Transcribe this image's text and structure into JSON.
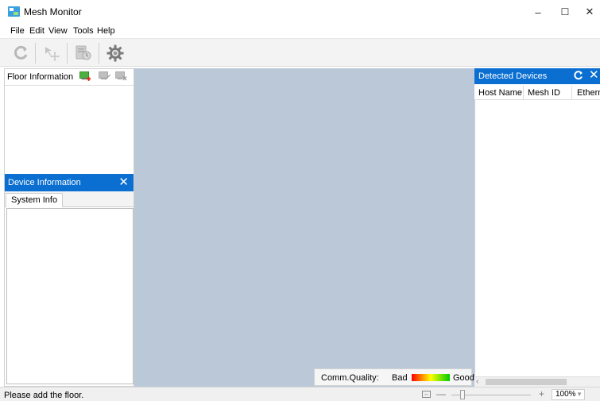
{
  "window": {
    "title": "Mesh Monitor",
    "minimize_glyph": "–",
    "maximize_glyph": "☐",
    "close_glyph": "✕"
  },
  "menu": {
    "items": [
      {
        "label": "File"
      },
      {
        "label": "Edit"
      },
      {
        "label": "View"
      },
      {
        "label": "Tools"
      },
      {
        "label": "Help"
      }
    ]
  },
  "toolbar": {
    "buttons": [
      {
        "icon": "refresh-icon",
        "enabled": false
      },
      {
        "icon": "pointer-move-icon",
        "enabled": false
      },
      {
        "icon": "device-settings-icon",
        "enabled": false
      },
      {
        "icon": "gear-icon",
        "enabled": true
      }
    ]
  },
  "floor_panel": {
    "title": "Floor Information",
    "icons": [
      "add-floor-icon",
      "edit-floor-icon",
      "delete-floor-icon"
    ]
  },
  "device_panel": {
    "title": "Device Information",
    "close_glyph": "✕",
    "tabs": [
      {
        "label": "System Info"
      }
    ]
  },
  "canvas": {
    "quality_label": "Comm.Quality:",
    "bad_label": "Bad",
    "good_label": "Good",
    "gradient_colors": [
      "#ff0000",
      "#ffff00",
      "#00cc00"
    ]
  },
  "detected_panel": {
    "title": "Detected Devices",
    "close_glyph": "✕",
    "columns": [
      "Host Name",
      "Mesh ID",
      "Ethernet"
    ]
  },
  "statusbar": {
    "message": "Please add the floor.",
    "zoom_minus": "—",
    "zoom_plus": "+",
    "zoom_value": "100%"
  },
  "colors": {
    "accent": "#0a6fd1",
    "canvas": "#bac8d8"
  }
}
